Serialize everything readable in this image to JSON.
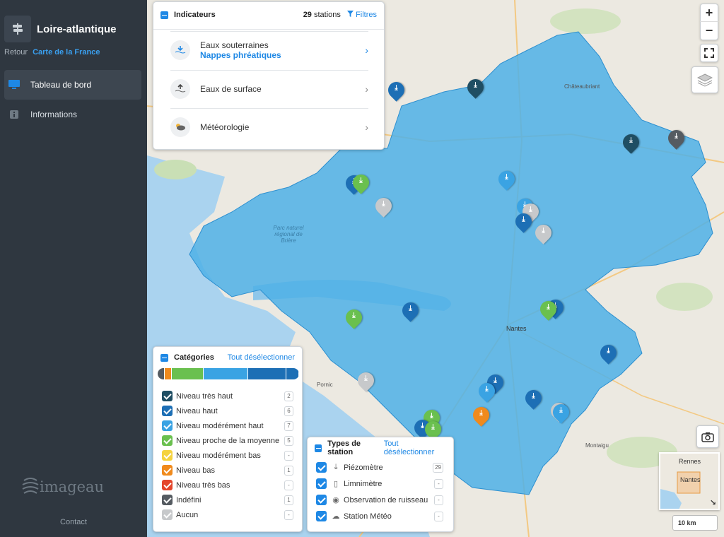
{
  "sidebar": {
    "title": "Loire-atlantique",
    "back_label": "Retour",
    "back_link": "Carte de la France",
    "nav": [
      {
        "label": "Tableau de bord",
        "icon": "monitor-icon",
        "active": true
      },
      {
        "label": "Informations",
        "icon": "info-icon",
        "active": false
      }
    ],
    "logo_text": "imageau",
    "contact": "Contact"
  },
  "indicators": {
    "title": "Indicateurs",
    "stations_count": "29",
    "stations_label": "stations",
    "filters_label": "Filtres",
    "items": [
      {
        "label": "Eaux souterraines",
        "sublabel": "Nappes phréatiques",
        "icon": "groundwater-icon"
      },
      {
        "label": "Eaux de surface",
        "sublabel": "",
        "icon": "surface-water-icon"
      },
      {
        "label": "Météorologie",
        "sublabel": "",
        "icon": "weather-icon"
      }
    ]
  },
  "categories": {
    "title": "Catégories",
    "deselect_label": "Tout désélectionner",
    "items": [
      {
        "label": "Niveau très haut",
        "count": "2",
        "color": "#1f4e63"
      },
      {
        "label": "Niveau haut",
        "count": "6",
        "color": "#1d6fb5"
      },
      {
        "label": "Niveau modérément haut",
        "count": "7",
        "color": "#3aa3e3"
      },
      {
        "label": "Niveau proche de la moyenne",
        "count": "5",
        "color": "#6ac04f"
      },
      {
        "label": "Niveau modérément bas",
        "count": "-",
        "color": "#f5d33f"
      },
      {
        "label": "Niveau bas",
        "count": "1",
        "color": "#f08a1c"
      },
      {
        "label": "Niveau très bas",
        "count": "-",
        "color": "#e4462c"
      },
      {
        "label": "Indéfini",
        "count": "1",
        "color": "#555b61"
      },
      {
        "label": "Aucun",
        "count": "-",
        "color": "#c7c9cb"
      }
    ]
  },
  "station_types": {
    "title": "Types de station",
    "deselect_label": "Tout désélectionner",
    "items": [
      {
        "label": "Piézomètre",
        "count": "29",
        "icon": "piezometer-icon"
      },
      {
        "label": "Limnimètre",
        "count": "-",
        "icon": "limnimeter-icon"
      },
      {
        "label": "Observation de ruisseau",
        "count": "-",
        "icon": "eye-icon"
      },
      {
        "label": "Station Météo",
        "count": "-",
        "icon": "cloud-rain-icon"
      }
    ]
  },
  "map": {
    "places": [
      "Parc naturel régional de Brière",
      "Nantes",
      "Rennes",
      "Châteaubriant",
      "Pornic",
      "Montaigu"
    ],
    "scale_label": "10 km",
    "minimap_labels": [
      "Rennes",
      "Nantes"
    ]
  },
  "colors": {
    "accent": "#1e88e5",
    "region_fill": "#4fb0e6",
    "sidebar_bg": "#2f3740"
  }
}
